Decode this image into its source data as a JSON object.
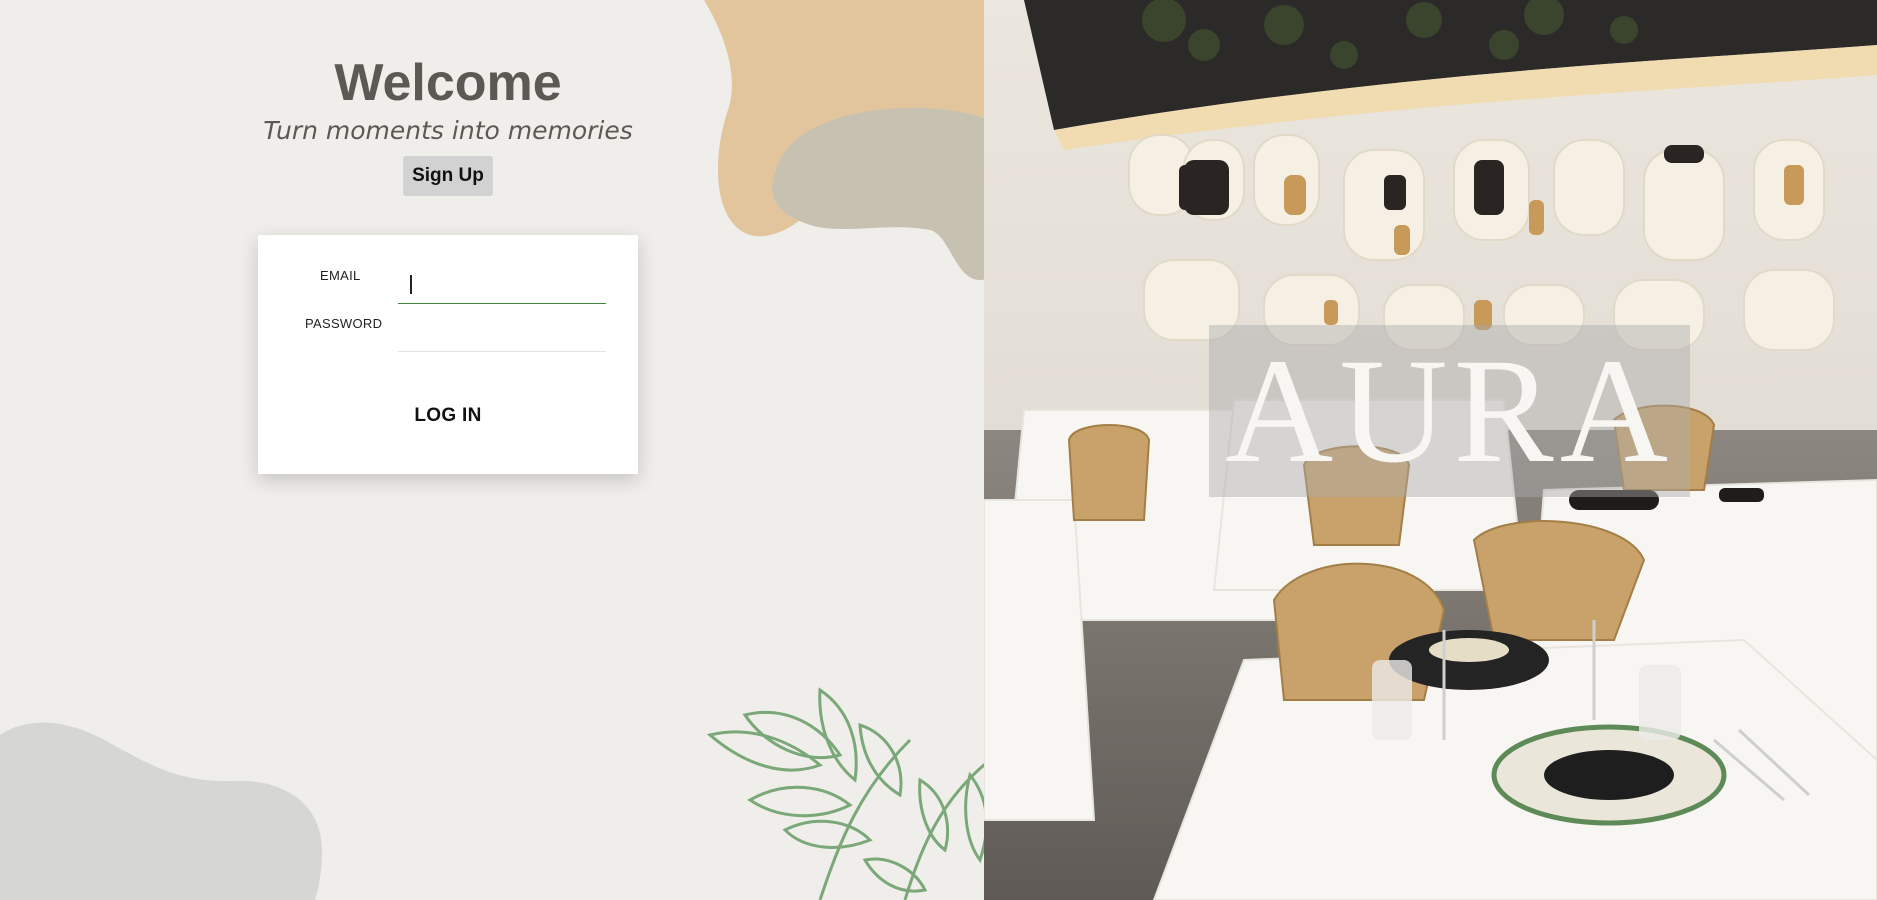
{
  "welcome": {
    "title": "Welcome",
    "tagline": "Turn moments into memories",
    "signup_label": "Sign Up"
  },
  "login_form": {
    "email_label": "EMAIL",
    "email_value": "",
    "password_label": "PASSWORD",
    "password_value": "",
    "login_label": "LOG IN"
  },
  "brand": {
    "name": "AURA"
  },
  "colors": {
    "background": "#f0eeea",
    "heading": "#5b5954",
    "accent_input": "#3d8a3d",
    "leaf_green": "#7aa878",
    "blob_tan": "#e2c59c",
    "blob_sage": "#c6c1b1",
    "blob_gray": "#d6d6d5"
  },
  "icons": {
    "decorations": [
      "tan-blob",
      "sage-blob",
      "gray-blob",
      "leaf-branch"
    ]
  }
}
